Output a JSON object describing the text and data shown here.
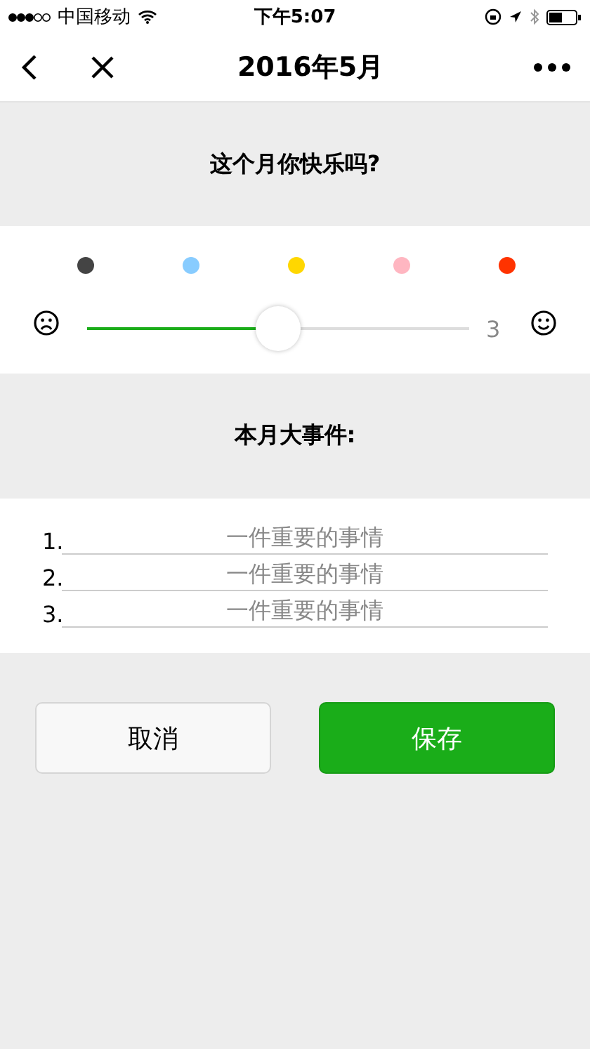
{
  "status_bar": {
    "carrier": "中国移动",
    "time": "下午5:07"
  },
  "nav": {
    "title": "2016年5月"
  },
  "question": "这个月你快乐吗?",
  "mood": {
    "colors": [
      {
        "color": "#444444"
      },
      {
        "color": "#88ccff"
      },
      {
        "color": "#ffd700"
      },
      {
        "color": "#ffb6c1"
      },
      {
        "color": "#ff3300"
      }
    ],
    "level": 0.5,
    "reading": "3"
  },
  "events_title": "本月大事件:",
  "events": [
    {
      "number": "1.",
      "placeholder": "一件重要的事情"
    },
    {
      "number": "2.",
      "placeholder": "一件重要的事情"
    },
    {
      "number": "3.",
      "placeholder": "一件重要的事情"
    }
  ],
  "buttons": [
    {
      "label": "取消",
      "kind": "secondary"
    },
    {
      "label": "保存",
      "kind": "primary"
    }
  ]
}
